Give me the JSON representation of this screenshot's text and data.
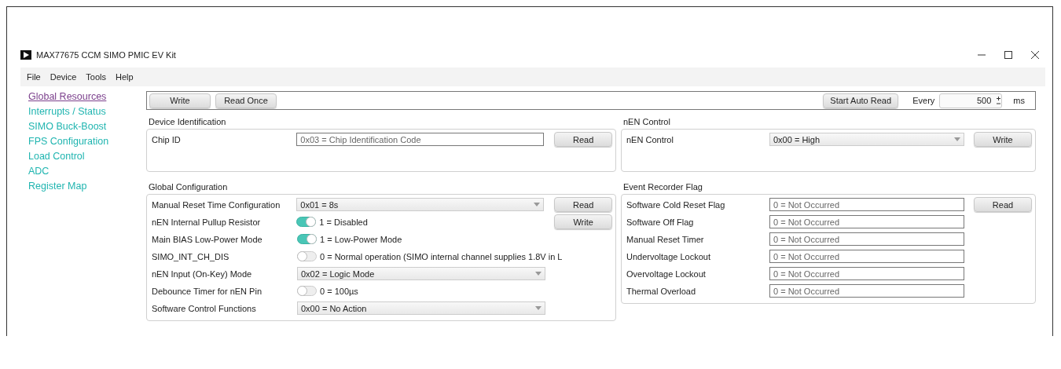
{
  "window": {
    "title": "MAX77675 CCM SIMO PMIC EV Kit"
  },
  "menu": [
    "File",
    "Device",
    "Tools",
    "Help"
  ],
  "sidebar": {
    "items": [
      {
        "label": "Global Resources",
        "selected": true
      },
      {
        "label": "Interrupts / Status",
        "selected": false
      },
      {
        "label": "SIMO Buck-Boost",
        "selected": false
      },
      {
        "label": "FPS Configuration",
        "selected": false
      },
      {
        "label": "Load Control",
        "selected": false
      },
      {
        "label": "ADC",
        "selected": false
      },
      {
        "label": "Register Map",
        "selected": false
      }
    ]
  },
  "toolbar": {
    "left_buttons": [
      "Write",
      "Read Once"
    ],
    "auto_read_button": "Start Auto Read",
    "interval_label": "Every",
    "interval_value": "500",
    "interval_unit": "ms"
  },
  "sections": [
    {
      "title": "Device Identification",
      "rows": [
        {
          "label": "Chip ID",
          "kind": "field",
          "value": "0x03 = Chip Identification Code",
          "button": "Read"
        }
      ]
    },
    {
      "title": "nEN Control",
      "rows": [
        {
          "label": "nEN Control",
          "kind": "dropdown",
          "value": "0x00 = High",
          "button": "Write"
        }
      ]
    },
    {
      "title": "Global Configuration",
      "rows": [
        {
          "label": "Manual Reset Time Configuration",
          "kind": "dropdown",
          "value": "0x01 = 8s",
          "button": "Read"
        },
        {
          "label": "nEN Internal Pullup Resistor",
          "kind": "toggle",
          "on": true,
          "value": "1 = Disabled",
          "button": "Write"
        },
        {
          "label": "Main BIAS Low-Power Mode",
          "kind": "toggle",
          "on": true,
          "value": "1 = Low-Power Mode"
        },
        {
          "label": "SIMO_INT_CH_DIS",
          "kind": "toggle",
          "on": false,
          "value": "0 = Normal operation (SIMO internal channel supplies 1.8V in L"
        },
        {
          "label": "nEN Input (On-Key) Mode",
          "kind": "dropdown",
          "value": "0x02 = Logic Mode"
        },
        {
          "label": "Debounce Timer for nEN Pin",
          "kind": "toggle",
          "on": false,
          "value": "0 = 100µs"
        },
        {
          "label": "Software Control Functions",
          "kind": "dropdown",
          "value": "0x00 = No Action"
        }
      ]
    },
    {
      "title": "Event Recorder Flag",
      "rows": [
        {
          "label": "Software Cold Reset Flag",
          "kind": "field",
          "value": "0 = Not Occurred",
          "button": "Read"
        },
        {
          "label": "Software Off Flag",
          "kind": "field",
          "value": "0 = Not Occurred"
        },
        {
          "label": "Manual Reset Timer",
          "kind": "field",
          "value": "0 = Not Occurred"
        },
        {
          "label": "Undervoltage Lockout",
          "kind": "field",
          "value": "0 = Not Occurred"
        },
        {
          "label": "Overvoltage Lockout",
          "kind": "field",
          "value": "0 = Not Occurred"
        },
        {
          "label": "Thermal Overload",
          "kind": "field",
          "value": "0 = Not Occurred"
        }
      ]
    }
  ]
}
